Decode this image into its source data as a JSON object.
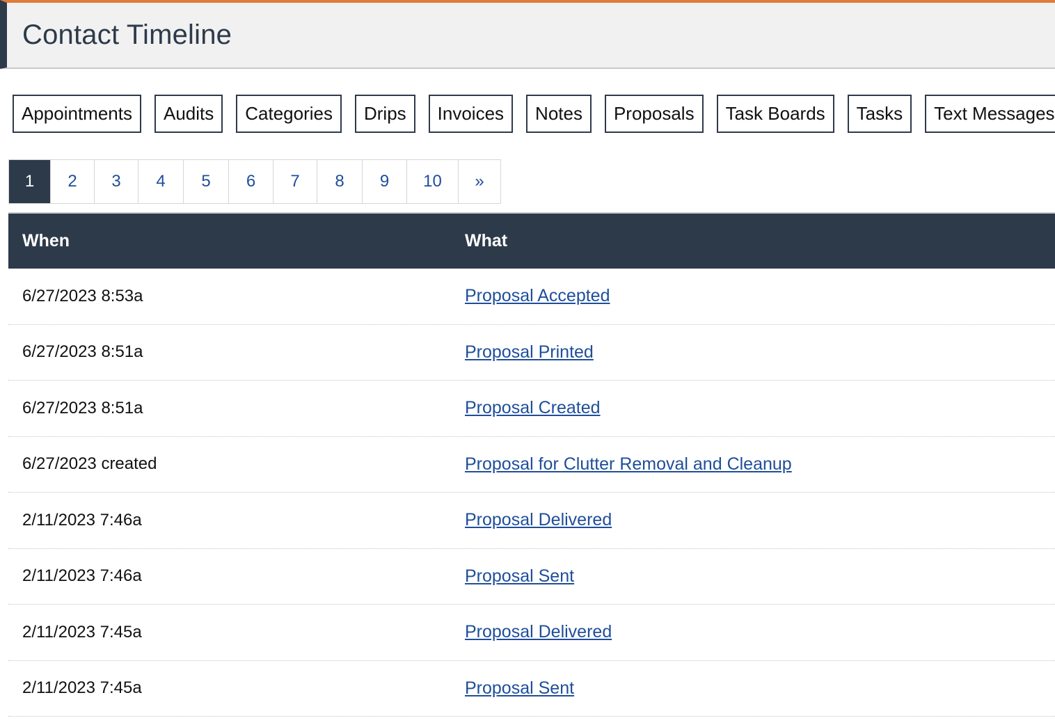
{
  "header": {
    "title": "Contact Timeline"
  },
  "filters": [
    "Appointments",
    "Audits",
    "Categories",
    "Drips",
    "Invoices",
    "Notes",
    "Proposals",
    "Task Boards",
    "Tasks",
    "Text Messages"
  ],
  "pagination": {
    "current": "1",
    "pages": [
      "1",
      "2",
      "3",
      "4",
      "5",
      "6",
      "7",
      "8",
      "9",
      "10"
    ],
    "next_label": "»"
  },
  "table": {
    "columns": {
      "when": "When",
      "what": "What"
    },
    "rows": [
      {
        "when": "6/27/2023 8:53a",
        "what": "Proposal Accepted"
      },
      {
        "when": "6/27/2023 8:51a",
        "what": "Proposal Printed"
      },
      {
        "when": "6/27/2023 8:51a",
        "what": "Proposal Created"
      },
      {
        "when": "6/27/2023 created",
        "what": "Proposal for Clutter Removal and Cleanup"
      },
      {
        "when": "2/11/2023 7:46a",
        "what": "Proposal Delivered"
      },
      {
        "when": "2/11/2023 7:46a",
        "what": "Proposal Sent"
      },
      {
        "when": "2/11/2023 7:45a",
        "what": "Proposal Delivered"
      },
      {
        "when": "2/11/2023 7:45a",
        "what": "Proposal Sent"
      }
    ]
  },
  "colors": {
    "accent_orange": "#e07b39",
    "navy": "#2d3a4a",
    "link_blue": "#1f4e9a"
  }
}
